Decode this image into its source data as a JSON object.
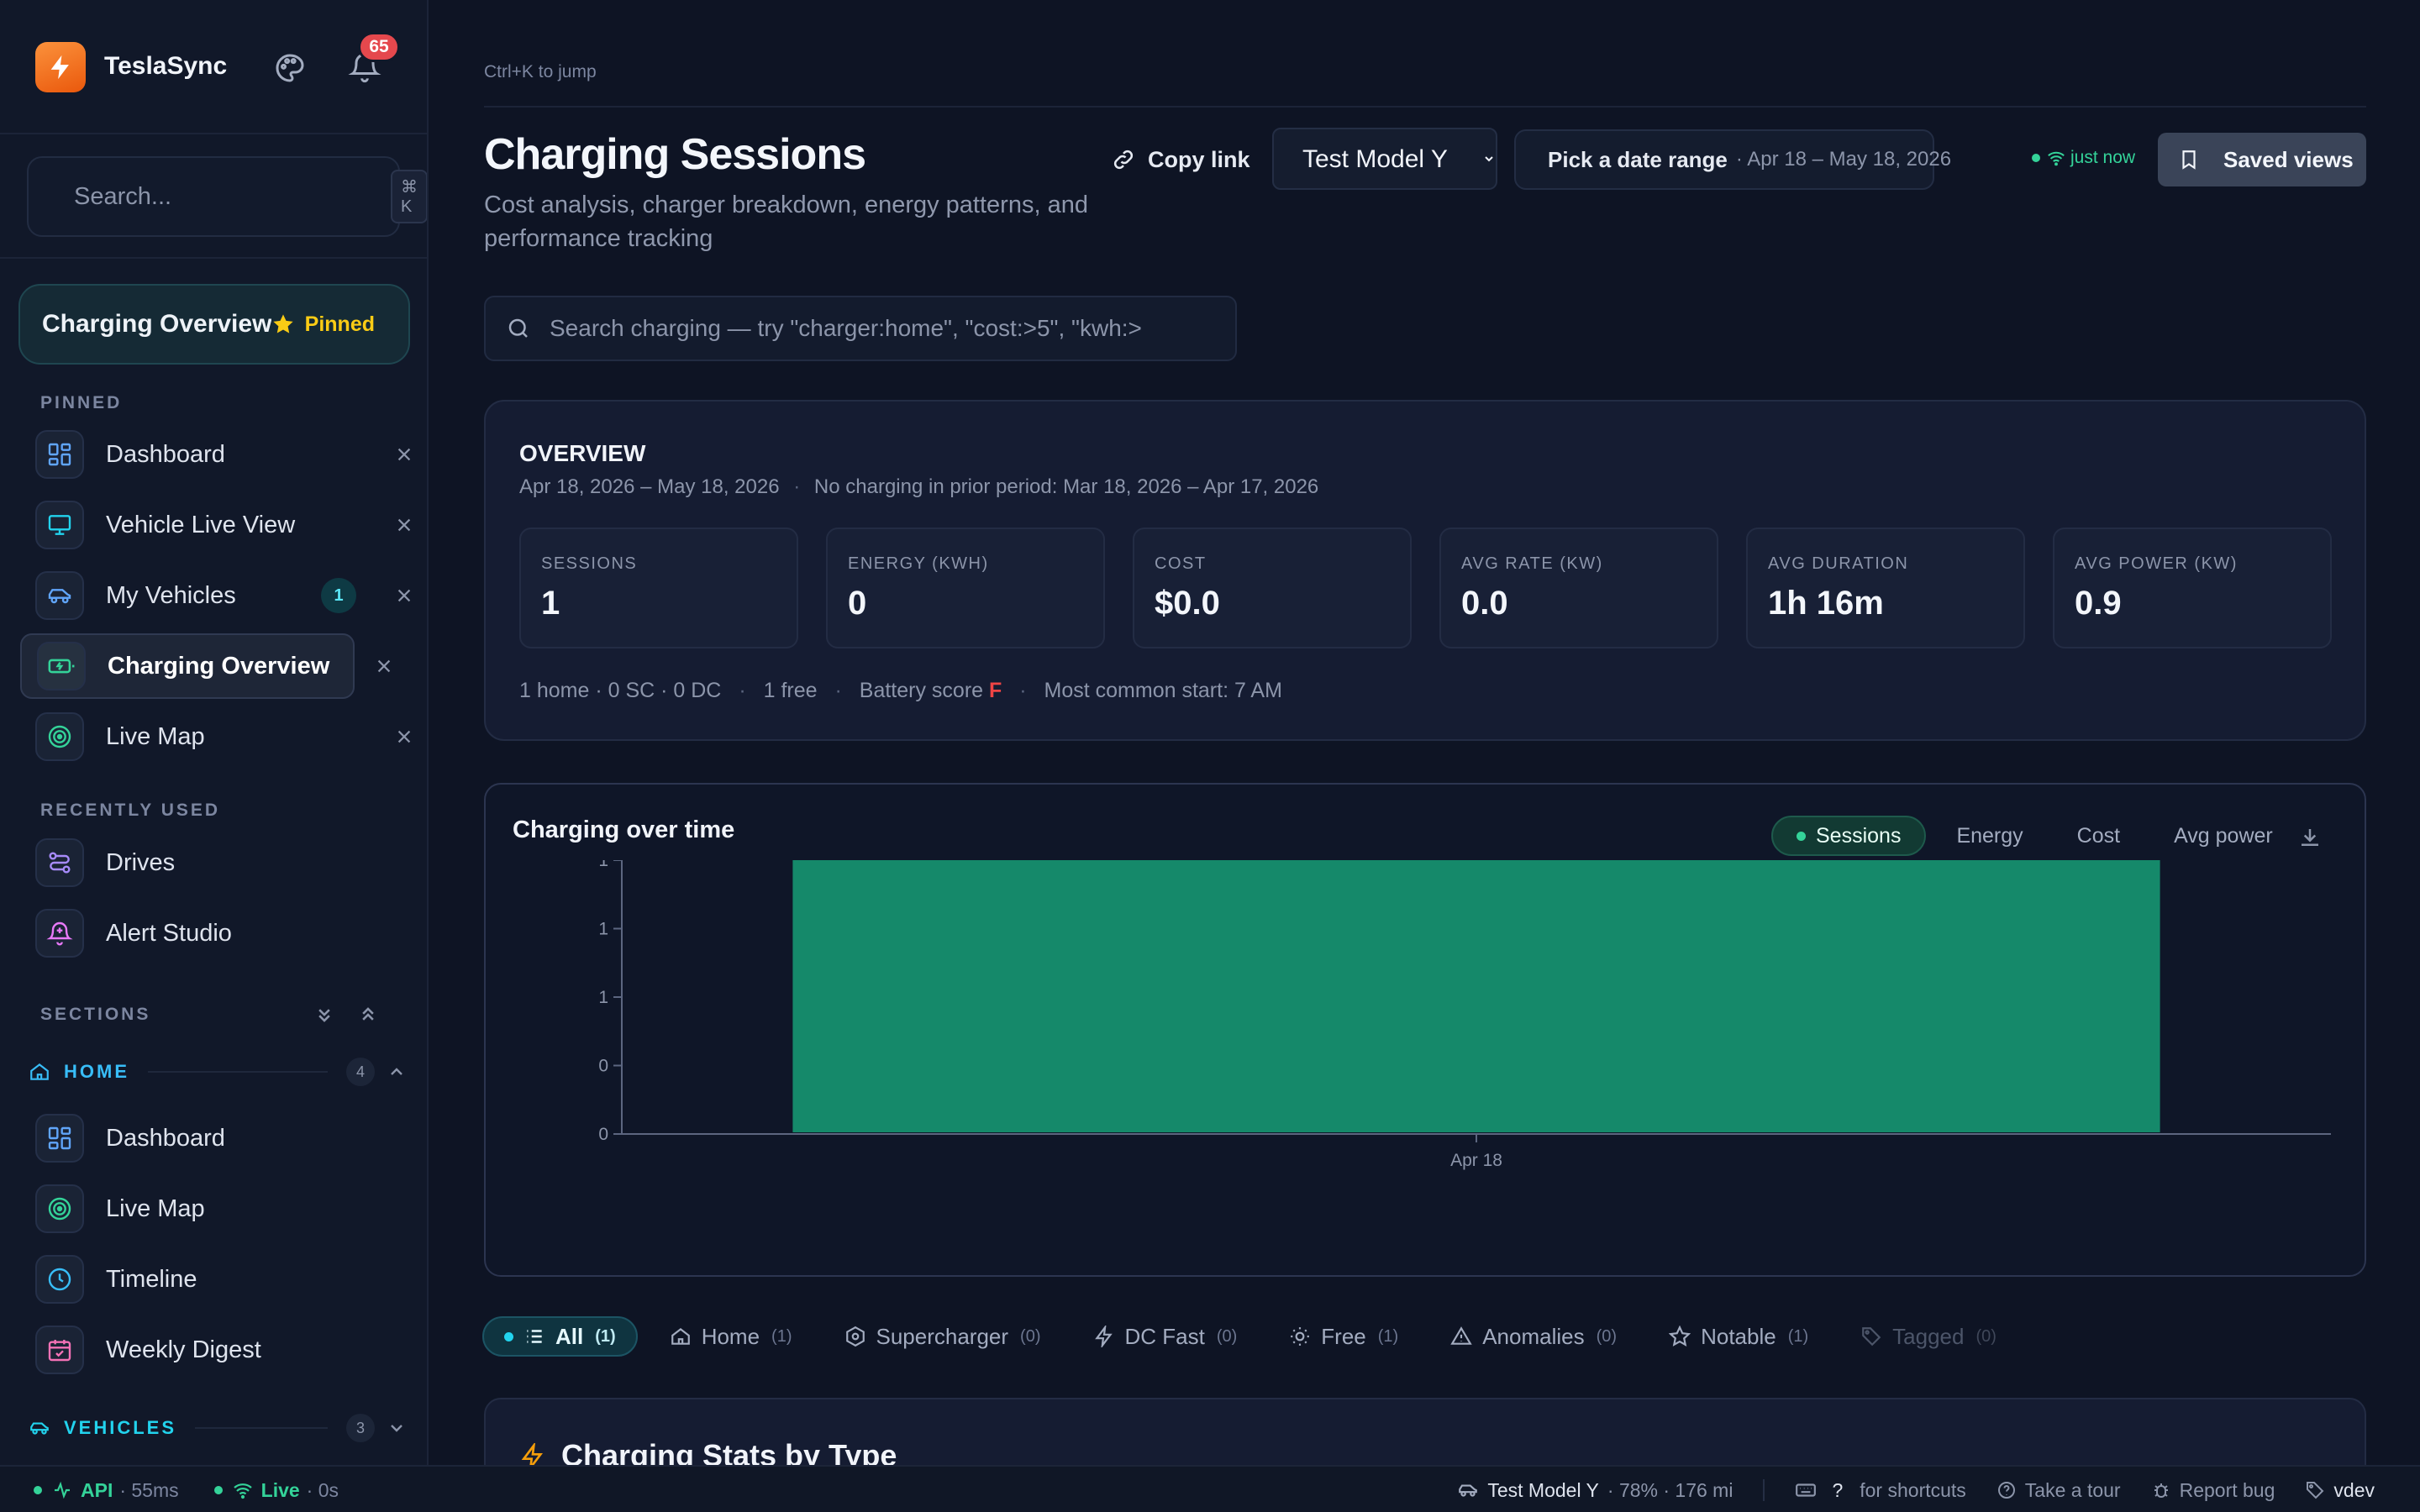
{
  "app": {
    "name": "TeslaSync",
    "notifications_count": "65"
  },
  "sidebar": {
    "search_placeholder": "Search...",
    "search_shortcut": "⌘ K",
    "current": {
      "title": "Charging Overview",
      "pinned_label": "Pinned"
    },
    "pinned_label": "PINNED",
    "pinned": [
      {
        "label": "Dashboard",
        "icon": "dashboard-icon"
      },
      {
        "label": "Vehicle Live View",
        "icon": "monitor-icon"
      },
      {
        "label": "My Vehicles",
        "icon": "car-icon",
        "badge": "1"
      },
      {
        "label": "Charging Overview",
        "icon": "battery-charging-icon",
        "active": true
      },
      {
        "label": "Live Map",
        "icon": "radar-icon"
      }
    ],
    "recent_label": "RECENTLY USED",
    "recent": [
      {
        "label": "Drives",
        "icon": "route-icon"
      },
      {
        "label": "Alert Studio",
        "icon": "bell-plus-icon"
      }
    ],
    "sections_label": "SECTIONS",
    "home_section": {
      "label": "HOME",
      "count": "4"
    },
    "home_items": [
      {
        "label": "Dashboard",
        "icon": "dashboard-icon"
      },
      {
        "label": "Live Map",
        "icon": "radar-icon"
      },
      {
        "label": "Timeline",
        "icon": "clock-icon"
      },
      {
        "label": "Weekly Digest",
        "icon": "calendar-check-icon"
      }
    ],
    "vehicles_section": {
      "label": "VEHICLES",
      "count": "3"
    }
  },
  "header": {
    "jump_hint": "Ctrl+K to jump",
    "title": "Charging Sessions",
    "subtitle": "Cost analysis, charger breakdown, energy patterns, and performance tracking",
    "copy_link": "Copy link",
    "vehicle": "Test Model Y",
    "date_label": "Pick a date range",
    "date_range": "· Apr 18 – May 18, 2026",
    "live_status": "just now",
    "saved_views": "Saved views"
  },
  "search": {
    "placeholder": "Search charging — try \"charger:home\", \"cost:>5\", \"kwh:>"
  },
  "overview": {
    "title": "OVERVIEW",
    "range": "Apr 18, 2026 – May 18, 2026",
    "prior": "No charging in prior period: Mar 18, 2026 – Apr 17, 2026",
    "stats": [
      {
        "label": "SESSIONS",
        "value": "1"
      },
      {
        "label": "ENERGY (KWH)",
        "value": "0"
      },
      {
        "label": "COST",
        "value": "$0.0"
      },
      {
        "label": "AVG RATE (KW)",
        "value": "0.0"
      },
      {
        "label": "AVG DURATION",
        "value": "1h 16m"
      },
      {
        "label": "AVG POWER (KW)",
        "value": "0.9"
      }
    ],
    "footer": {
      "chargers": "1 home · 0 SC · 0 DC",
      "free": "1 free",
      "battery_label": "Battery score",
      "battery_grade": "F",
      "common_start": "Most common start: 7 AM"
    }
  },
  "chart": {
    "title": "Charging over time",
    "tabs": [
      "Sessions",
      "Energy",
      "Cost",
      "Avg power"
    ],
    "active_tab": "Sessions",
    "bar_color": "#15896a"
  },
  "chart_data": {
    "type": "bar",
    "categories": [
      "Apr 18"
    ],
    "series": [
      {
        "values": [
          1
        ]
      }
    ],
    "y_ticks": [
      "0",
      "0",
      "1",
      "1",
      "1"
    ],
    "ylim": [
      0,
      1
    ],
    "grid": false
  },
  "filters": [
    {
      "label": "All",
      "count": "(1)",
      "active": true
    },
    {
      "label": "Home",
      "count": "(1)",
      "icon": "home-icon"
    },
    {
      "label": "Supercharger",
      "count": "(0)",
      "icon": "hexagon-icon"
    },
    {
      "label": "DC Fast",
      "count": "(0)",
      "icon": "bolt-icon"
    },
    {
      "label": "Free",
      "count": "(1)",
      "icon": "sun-icon"
    },
    {
      "label": "Anomalies",
      "count": "(0)",
      "icon": "warning-icon"
    },
    {
      "label": "Notable",
      "count": "(1)",
      "icon": "star-icon"
    },
    {
      "label": "Tagged",
      "count": "(0)",
      "icon": "tag-icon",
      "disabled": true
    }
  ],
  "stats_by_type": {
    "title": "Charging Stats by Type"
  },
  "statusbar": {
    "api_label": "API",
    "api_latency": "· 55ms",
    "live_label": "Live",
    "live_age": "· 0s",
    "vehicle": "Test Model Y",
    "vehicle_stats": "· 78% · 176 mi",
    "shortcut_key": "?",
    "shortcut_text": "for shortcuts",
    "tour": "Take a tour",
    "report": "Report bug",
    "env": "vdev"
  },
  "colors": {
    "accent": "#34d399",
    "brand": "#f97316",
    "badge": "#e5484d"
  }
}
